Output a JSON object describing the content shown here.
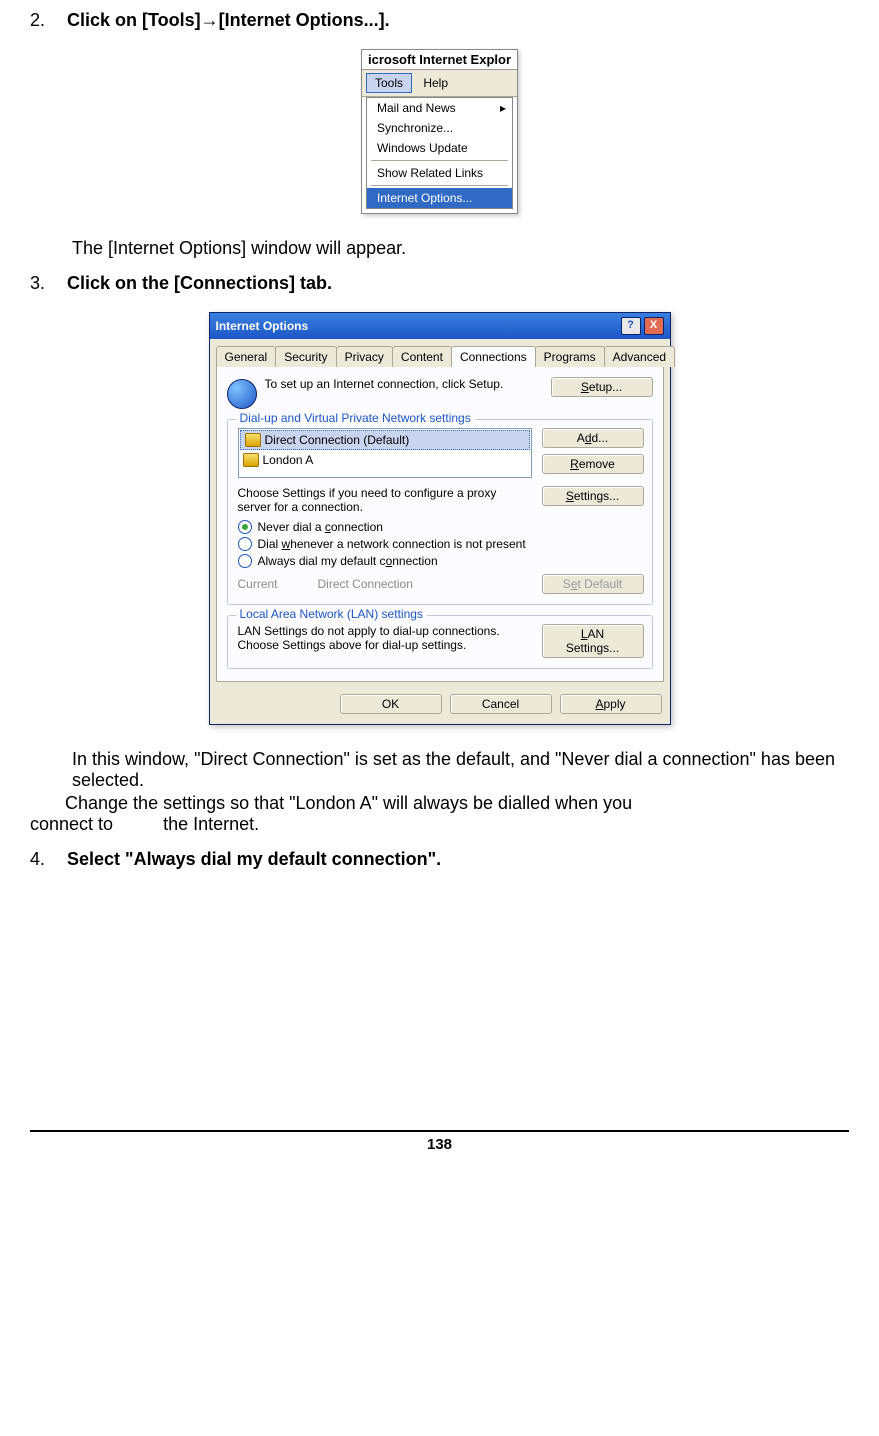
{
  "step2": {
    "num": "2.",
    "text": "Click on [Tools]→[Internet Options...]."
  },
  "ie_menu": {
    "title_fragment": "icrosoft Internet Explor",
    "menubar": {
      "tools": "Tools",
      "help": "Help"
    },
    "items": {
      "mail": "Mail and News",
      "sync": "Synchronize...",
      "wu": "Windows Update",
      "srl": "Show Related Links",
      "io": "Internet Options..."
    }
  },
  "after2": "The [Internet Options] window will appear.",
  "step3": {
    "num": "3.",
    "text": "Click on the [Connections] tab."
  },
  "dlg": {
    "title": "Internet Options",
    "help_btn": "?",
    "close_btn": "X",
    "tabs": {
      "general": "General",
      "security": "Security",
      "privacy": "Privacy",
      "content": "Content",
      "connections": "Connections",
      "programs": "Programs",
      "advanced": "Advanced"
    },
    "setup_text": "To set up an Internet connection, click Setup.",
    "setup_btn": "Setup...",
    "fs_dialup": "Dial-up and Virtual Private Network settings",
    "conn1": "Direct Connection (Default)",
    "conn2": "London A",
    "add_btn": "Add...",
    "remove_btn": "Remove",
    "settings_hint": "Choose Settings if you need to configure a proxy server for a connection.",
    "settings_btn": "Settings...",
    "r_never": "Never dial a connection",
    "r_when": "Dial whenever a network connection is not present",
    "r_always": "Always dial my default connection",
    "current_lbl": "Current",
    "current_val": "Direct Connection",
    "setdefault_btn": "Set Default",
    "fs_lan": "Local Area Network (LAN) settings",
    "lan_text": "LAN Settings do not apply to dial-up connections. Choose Settings above for dial-up settings.",
    "lan_btn": "LAN Settings...",
    "ok": "OK",
    "cancel": "Cancel",
    "apply": "Apply"
  },
  "after3a": "In this window, \"Direct Connection\" is set as the default, and \"Never dial a connection\" has been selected.",
  "after3b": "Change the settings so that \"London A\" will always be dialled when you connect to          the Internet.",
  "step4": {
    "num": "4.",
    "text": "Select \"Always dial my default connection\"."
  },
  "page_num": "138"
}
